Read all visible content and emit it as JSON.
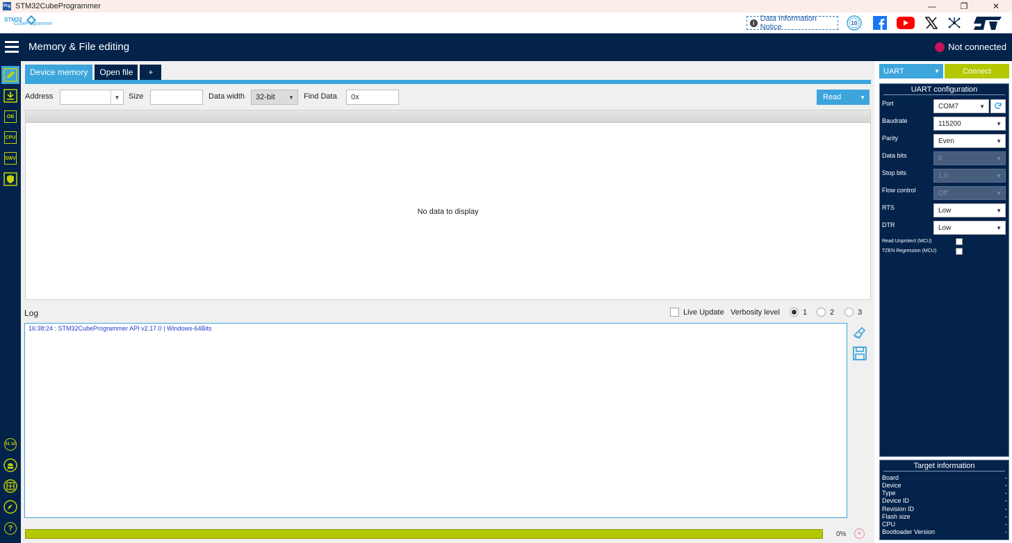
{
  "window": {
    "title": "STM32CubeProgrammer",
    "app_icon": "Prg",
    "controls": [
      "—",
      "❐",
      "✕"
    ]
  },
  "brand": {
    "logo_line1": "STM32",
    "logo_line2": "CubeProgrammer",
    "notice": "Data Information Notice",
    "badge": "10"
  },
  "header": {
    "title": "Memory & File editing",
    "status": "Not connected",
    "status_color": "#c8125c"
  },
  "sidebar": {
    "icons": [
      "pencil-icon",
      "download-icon",
      "ob-icon",
      "cpu-icon",
      "swv-icon",
      "shield-icon",
      "binary-icon",
      "android-icon",
      "globe-icon",
      "rocket-icon",
      "help-icon"
    ],
    "labels": {
      "ob": "OB",
      "cpu": "CPU",
      "swv": "SWV",
      "binary": "01 10",
      "help": "?"
    }
  },
  "tabs": [
    {
      "label": "Device memory",
      "active": true
    },
    {
      "label": "Open file",
      "active": false
    },
    {
      "label": "+",
      "active": false
    }
  ],
  "toolbar": {
    "address_label": "Address",
    "address_value": "",
    "size_label": "Size",
    "size_value": "",
    "data_width_label": "Data width",
    "data_width_value": "32-bit",
    "find_label": "Find Data",
    "find_value": "0x",
    "read_label": "Read"
  },
  "memory": {
    "empty_text": "No data to display"
  },
  "log": {
    "label": "Log",
    "live_update": "Live Update",
    "verbosity_label": "Verbosity level",
    "levels": [
      "1",
      "2",
      "3"
    ],
    "selected_level": "1",
    "lines": [
      "16:38:24 : STM32CubeProgrammer API v2.17.0 | Windows-64Bits"
    ]
  },
  "progress": {
    "percent_text": "0%",
    "fraction": 1.0
  },
  "connection": {
    "interface": "UART",
    "connect_label": "Connect",
    "config_title": "UART configuration",
    "fields": [
      {
        "label": "Port",
        "value": "COM7",
        "enabled": true
      },
      {
        "label": "Baudrate",
        "value": "115200",
        "enabled": true
      },
      {
        "label": "Parity",
        "value": "Even",
        "enabled": true
      },
      {
        "label": "Data bits",
        "value": "8",
        "enabled": false
      },
      {
        "label": "Stop bits",
        "value": "1.0",
        "enabled": false
      },
      {
        "label": "Flow control",
        "value": "Off",
        "enabled": false
      },
      {
        "label": "RTS",
        "value": "Low",
        "enabled": true
      },
      {
        "label": "DTR",
        "value": "Low",
        "enabled": true
      }
    ],
    "read_unprotect": "Read Unprotect (MCU)",
    "tzen_regression": "TZEN Regression (MCU)"
  },
  "target": {
    "title": "Target information",
    "rows": [
      {
        "label": "Board",
        "value": "-"
      },
      {
        "label": "Device",
        "value": "-"
      },
      {
        "label": "Type",
        "value": "-"
      },
      {
        "label": "Device ID",
        "value": "-"
      },
      {
        "label": "Revision ID",
        "value": "-"
      },
      {
        "label": "Flash size",
        "value": "-"
      },
      {
        "label": "CPU",
        "value": "-"
      },
      {
        "label": "Bootloader Version",
        "value": "-"
      }
    ]
  },
  "colors": {
    "navy": "#03234b",
    "blue": "#3ba5dc",
    "lime": "#b4c800"
  }
}
